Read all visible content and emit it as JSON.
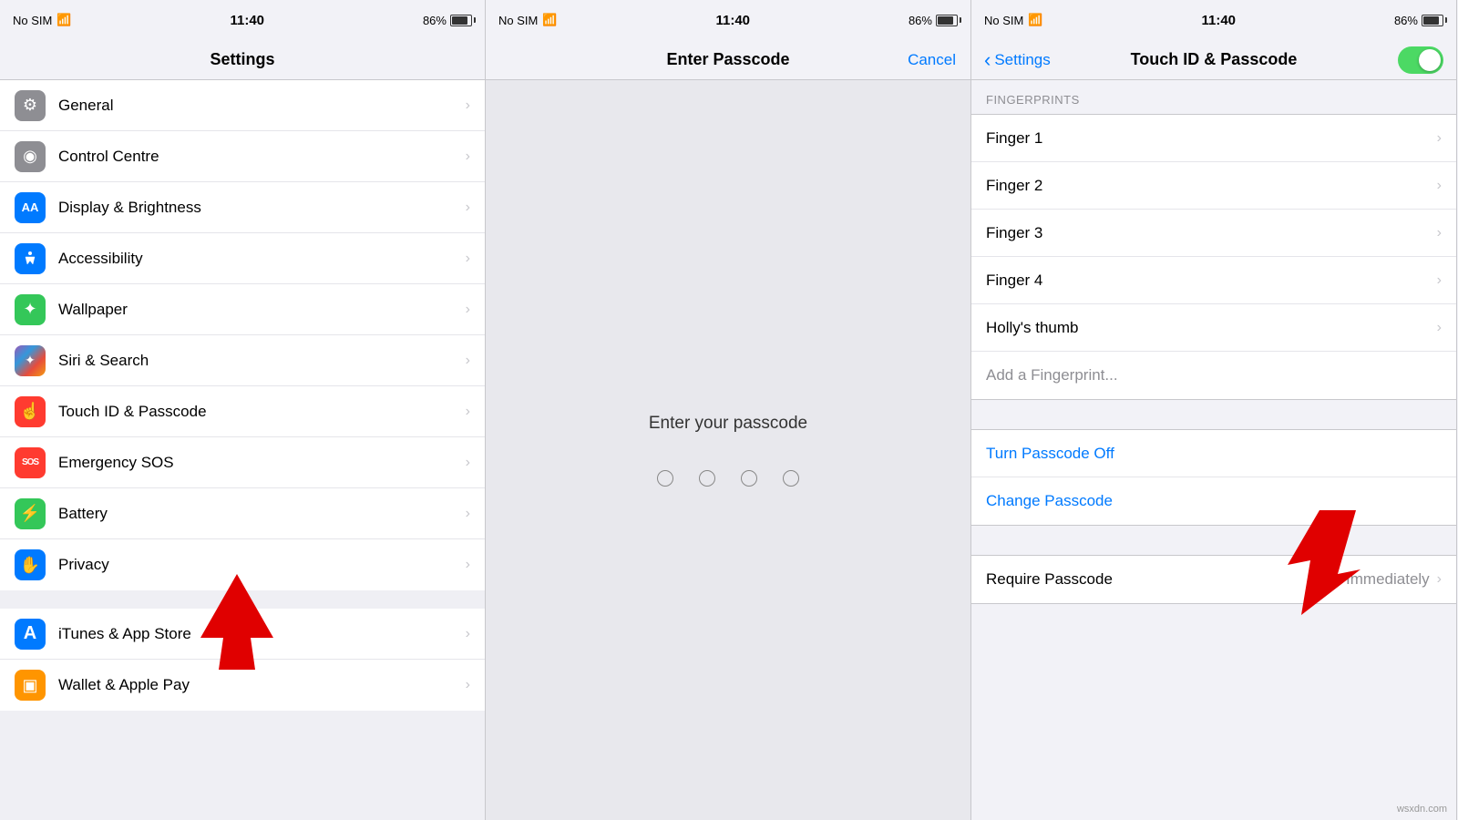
{
  "statusBar": {
    "signal": "No SIM",
    "wifi": "▾",
    "time": "11:40",
    "battery": "86%"
  },
  "panel1": {
    "title": "Settings",
    "items": [
      {
        "id": "general",
        "label": "General",
        "iconBg": "#8e8e93",
        "iconChar": "⚙"
      },
      {
        "id": "control-centre",
        "label": "Control Centre",
        "iconBg": "#8e8e93",
        "iconChar": "◉"
      },
      {
        "id": "display-brightness",
        "label": "Display & Brightness",
        "iconBg": "#007aff",
        "iconChar": "AA"
      },
      {
        "id": "accessibility",
        "label": "Accessibility",
        "iconBg": "#007aff",
        "iconChar": "♿"
      },
      {
        "id": "wallpaper",
        "label": "Wallpaper",
        "iconBg": "#34c759",
        "iconChar": "✦"
      },
      {
        "id": "siri-search",
        "label": "Siri & Search",
        "iconBg": "#000000",
        "iconChar": "◈"
      },
      {
        "id": "touch-id-passcode",
        "label": "Touch ID & Passcode",
        "iconBg": "#ff3b30",
        "iconChar": "☝"
      },
      {
        "id": "emergency-sos",
        "label": "Emergency SOS",
        "iconBg": "#ff3b30",
        "iconChar": "SOS"
      },
      {
        "id": "battery",
        "label": "Battery",
        "iconBg": "#34c759",
        "iconChar": "▬"
      },
      {
        "id": "privacy",
        "label": "Privacy",
        "iconBg": "#007aff",
        "iconChar": "✋"
      }
    ],
    "section2Items": [
      {
        "id": "itunes-app-store",
        "label": "iTunes & App Store",
        "iconBg": "#007aff",
        "iconChar": "A"
      },
      {
        "id": "wallet-apple-pay",
        "label": "Wallet & Apple Pay",
        "iconBg": "#ff9500",
        "iconChar": "▣"
      }
    ]
  },
  "panel2": {
    "title": "Enter Passcode",
    "cancelLabel": "Cancel",
    "prompt": "Enter your passcode",
    "dots": [
      0,
      0,
      0,
      0
    ]
  },
  "panel3": {
    "navBack": "Settings",
    "title": "Touch ID & Passcode",
    "fingerprintsHeader": "FINGERPRINTS",
    "fingerprints": [
      {
        "label": "Finger 1"
      },
      {
        "label": "Finger 2"
      },
      {
        "label": "Finger 3"
      },
      {
        "label": "Finger 4"
      },
      {
        "label": "Holly's thumb"
      }
    ],
    "addFingerprint": "Add a Fingerprint...",
    "turnPasscodeOff": "Turn Passcode Off",
    "changePasscode": "Change Passcode",
    "requirePasscodeLabel": "Require Passcode",
    "requirePasscodeValue": "Immediately"
  },
  "watermark": "wsxdn.com"
}
